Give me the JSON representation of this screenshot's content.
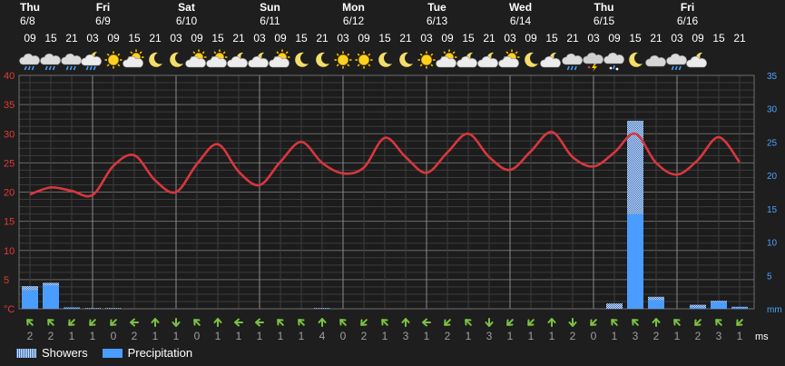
{
  "days": [
    {
      "name": "Thu",
      "date": "6/8"
    },
    {
      "name": "Fri",
      "date": "6/9"
    },
    {
      "name": "Sat",
      "date": "6/10"
    },
    {
      "name": "Sun",
      "date": "6/11"
    },
    {
      "name": "Mon",
      "date": "6/12"
    },
    {
      "name": "Tue",
      "date": "6/13"
    },
    {
      "name": "Wed",
      "date": "6/14"
    },
    {
      "name": "Thu",
      "date": "6/15"
    },
    {
      "name": "Fri",
      "date": "6/16"
    }
  ],
  "hours": [
    "09",
    "15",
    "21",
    "03",
    "09",
    "15",
    "21",
    "03",
    "09",
    "15",
    "21",
    "03",
    "09",
    "15",
    "21",
    "03",
    "09",
    "15",
    "21",
    "03",
    "09",
    "15",
    "21",
    "03",
    "09",
    "15",
    "21",
    "03",
    "09",
    "15",
    "21",
    "03",
    "09",
    "15",
    "21"
  ],
  "weather_icons": [
    "rain-cloud",
    "rain-cloud",
    "rain-cloud",
    "partly-cloudy-night-rain",
    "sun",
    "partly-cloudy",
    "moon",
    "moon",
    "partly-cloudy",
    "partly-cloudy",
    "partly-cloudy-night",
    "partly-cloudy-night",
    "partly-cloudy",
    "moon",
    "moon",
    "sun",
    "sun",
    "moon",
    "moon",
    "sun",
    "partly-cloudy",
    "partly-cloudy-night",
    "partly-cloudy-night",
    "partly-cloudy",
    "moon",
    "partly-cloudy-night",
    "rain-cloud",
    "thunderstorm",
    "snow-rain",
    "moon",
    "cloudy",
    "rain-cloud",
    "partly-cloudy-night"
  ],
  "wind_dirs": [
    135,
    135,
    45,
    45,
    45,
    90,
    180,
    0,
    135,
    180,
    90,
    90,
    135,
    135,
    180,
    135,
    45,
    135,
    180,
    90,
    45,
    135,
    0,
    45,
    45,
    180,
    0,
    45,
    135,
    135,
    180,
    135,
    45,
    135,
    45
  ],
  "wind_speeds": [
    "2",
    "2",
    "1",
    "1",
    "0",
    "2",
    "1",
    "1",
    "0",
    "1",
    "1",
    "1",
    "1",
    "1",
    "4",
    "0",
    "2",
    "1",
    "3",
    "1",
    "2",
    "1",
    "3",
    "1",
    "1",
    "1",
    "2",
    "0",
    "1",
    "3",
    "2",
    "1",
    "2",
    "3",
    "1"
  ],
  "wind_unit": "ms",
  "legend": {
    "showers": "Showers",
    "precipitation": "Precipitation"
  },
  "colors": {
    "temperature": "#d9363e",
    "precipitation": "#4a9dff",
    "showers": "#a9c8f0",
    "left_axis": "#e53935",
    "right_axis": "#4aa3ff",
    "wind_arrow": "#7cc241"
  },
  "chart_data": {
    "type": "line",
    "x": [
      "06-08 09",
      "06-08 15",
      "06-08 21",
      "06-09 03",
      "06-09 09",
      "06-09 15",
      "06-09 21",
      "06-10 03",
      "06-10 09",
      "06-10 15",
      "06-10 21",
      "06-11 03",
      "06-11 09",
      "06-11 15",
      "06-11 21",
      "06-12 03",
      "06-12 09",
      "06-12 15",
      "06-12 21",
      "06-13 03",
      "06-13 09",
      "06-13 15",
      "06-13 21",
      "06-14 03",
      "06-14 09",
      "06-14 15",
      "06-14 21",
      "06-15 03",
      "06-15 09",
      "06-15 15",
      "06-15 21",
      "06-16 03",
      "06-16 09",
      "06-16 15",
      "06-16 21"
    ],
    "series": [
      {
        "axis": "left",
        "unit": "°C",
        "values": [
          19.6,
          20.8,
          20.2,
          19.5,
          24.5,
          26.3,
          22.0,
          20.0,
          24.8,
          28.2,
          23.5,
          21.2,
          25.2,
          28.6,
          25.0,
          23.2,
          24.2,
          29.3,
          26.0,
          23.3,
          26.8,
          30.0,
          26.0,
          23.8,
          27.0,
          30.3,
          26.0,
          24.4,
          26.8,
          30.0,
          25.0,
          23.0,
          25.5,
          29.4,
          25.1
        ]
      },
      {
        "axis": "right",
        "unit": "mm",
        "type": "bar",
        "values": [
          2.8,
          3.5,
          0.1,
          0,
          0,
          0,
          0,
          0,
          0,
          0,
          0,
          0,
          0,
          0,
          0,
          0,
          0,
          0,
          0,
          0,
          0,
          0,
          0,
          0,
          0,
          0,
          0,
          0,
          0,
          14.2,
          1.3,
          0,
          0.2,
          1.0,
          0.2
        ]
      },
      {
        "axis": "right",
        "unit": "mm",
        "type": "bar",
        "values": [
          3.4,
          3.9,
          0.2,
          0.1,
          0.1,
          0,
          0,
          0,
          0,
          0,
          0,
          0,
          0,
          0,
          0.1,
          0,
          0,
          0,
          0,
          0,
          0,
          0,
          0,
          0,
          0,
          0,
          0,
          0,
          0.8,
          28.2,
          1.8,
          0,
          0.6,
          1.2,
          0.3
        ]
      }
    ],
    "ylim": [
      0,
      40
    ],
    "y2lim": [
      0,
      35
    ],
    "yticks": [
      "°C",
      "5",
      "10",
      "15",
      "20",
      "25",
      "30",
      "35",
      "40"
    ],
    "y2ticks": [
      "mm",
      "5",
      "10",
      "15",
      "20",
      "25",
      "30",
      "35"
    ],
    "grid": true
  }
}
